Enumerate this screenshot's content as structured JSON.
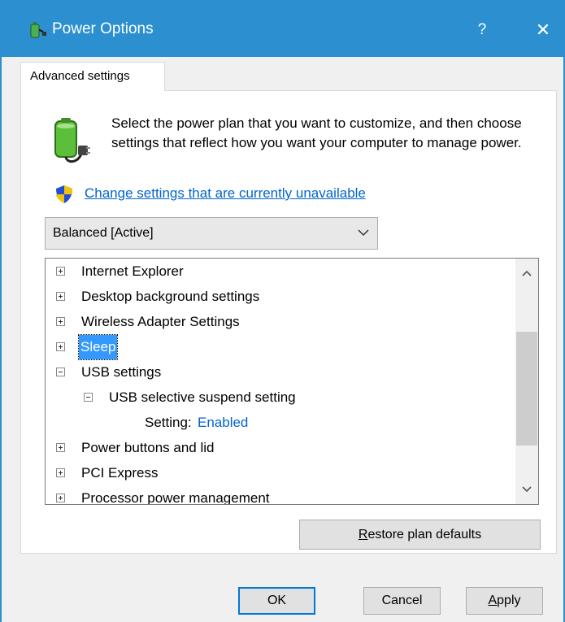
{
  "window": {
    "title": "Power Options",
    "help_label": "?",
    "close_label": "✕",
    "accent_color": "#2b8fd0"
  },
  "tab": {
    "label": "Advanced settings"
  },
  "description": "Select the power plan that you want to customize, and then choose settings that reflect how you want your computer to manage power.",
  "change_link": "Change settings that are currently unavailable",
  "plan_select": {
    "value": "Balanced [Active]"
  },
  "tree": {
    "items": [
      {
        "label": "Internet Explorer",
        "state": "collapsed"
      },
      {
        "label": "Desktop background settings",
        "state": "collapsed"
      },
      {
        "label": "Wireless Adapter Settings",
        "state": "collapsed"
      },
      {
        "label": "Sleep",
        "state": "collapsed",
        "selected": true
      },
      {
        "label": "USB settings",
        "state": "expanded"
      },
      {
        "label": "USB selective suspend setting",
        "state": "expanded"
      },
      {
        "label": "Setting:",
        "value": "Enabled"
      },
      {
        "label": "Power buttons and lid",
        "state": "collapsed"
      },
      {
        "label": "PCI Express",
        "state": "collapsed"
      },
      {
        "label": "Processor power management",
        "state": "collapsed"
      }
    ]
  },
  "buttons": {
    "restore_pre": "",
    "restore_key": "R",
    "restore_post": "estore plan defaults",
    "ok": "OK",
    "cancel": "Cancel",
    "apply_key": "A",
    "apply_post": "pply"
  }
}
